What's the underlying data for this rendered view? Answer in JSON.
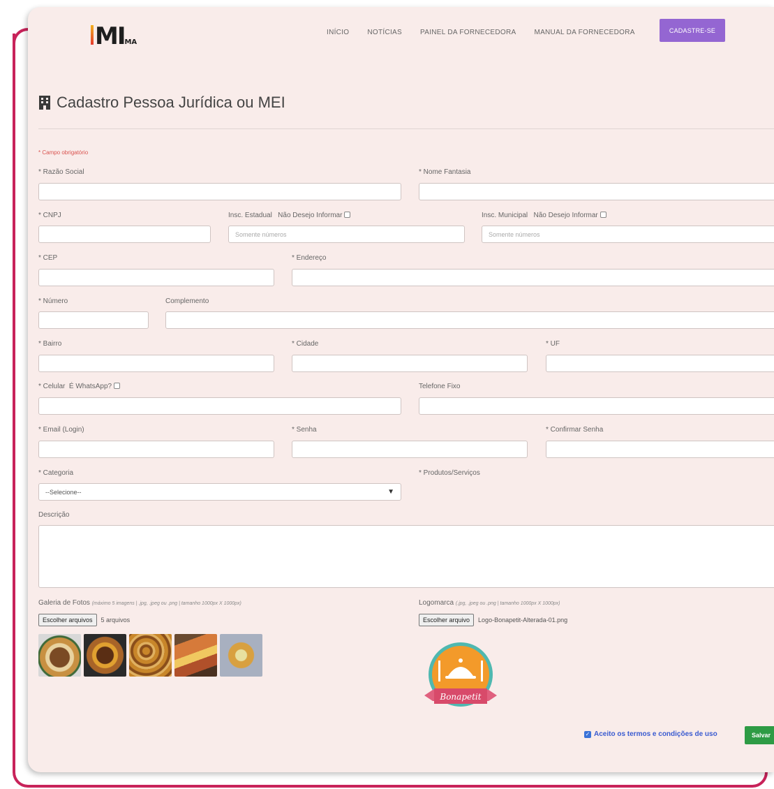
{
  "nav": {
    "logo_text": "MI",
    "logo_suffix": "MA",
    "links": [
      "INÍCIO",
      "NOTÍCIAS",
      "PAINEL DA FORNECEDORA",
      "MANUAL DA FORNECEDORA"
    ],
    "cta": "CADASTRE-SE"
  },
  "page_title": "Cadastro Pessoa Jurídica ou MEI",
  "required_note": "* Campo obrigatório",
  "fields": {
    "razao_social": "* Razão Social",
    "nome_fantasia": "* Nome Fantasia",
    "cnpj": "* CNPJ",
    "insc_estadual": "Insc. Estadual",
    "insc_municipal": "Insc. Municipal",
    "nao_desejo": "Não Desejo Informar",
    "somente_numeros": "Somente números",
    "cep": "* CEP",
    "endereco": "* Endereço",
    "numero": "* Número",
    "complemento": "Complemento",
    "bairro": "* Bairro",
    "cidade": "* Cidade",
    "uf": "* UF",
    "celular": "* Celular",
    "whatsapp": "É WhatsApp?",
    "telefone_fixo": "Telefone Fixo",
    "email": "* Email (Login)",
    "senha": "* Senha",
    "confirmar_senha": "* Confirmar Senha",
    "categoria": "* Categoria",
    "categoria_value": "--Selecione--",
    "produtos": "* Produtos/Serviços",
    "descricao": "Descrição"
  },
  "gallery": {
    "label": "Galeria de Fotos",
    "note": "(máximo 5 imagens | .jpg, .jpeg ou .png | tamanho 1000px X 1000px)",
    "button": "Escolher arquivos",
    "status": "5 arquivos"
  },
  "logomarca": {
    "label": "Logomarca",
    "note": "(.jpg, .jpeg ou .png | tamanho 1000px X 1000px)",
    "button": "Escolher arquivo",
    "status": "Logo-Bonapetit-Alterada-01.png",
    "badge_text": "Bonapetit"
  },
  "footer": {
    "terms": "Aceito os termos e condições de uso",
    "save": "Salvar"
  },
  "colors": {
    "accent_purple": "#9466d2",
    "frame_pink": "#c8235a",
    "save_green": "#2e9b45",
    "card_bg": "#f9ecea"
  }
}
